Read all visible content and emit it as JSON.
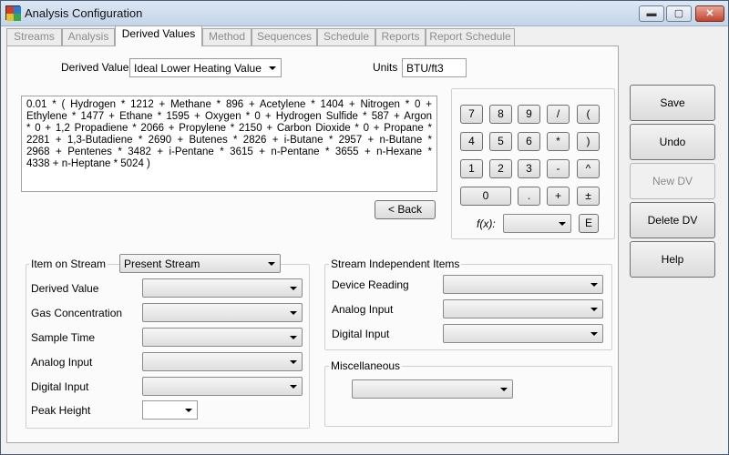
{
  "window": {
    "title": "Analysis Configuration",
    "controls": {
      "minimize": "▬",
      "maximize": "▢",
      "close": "✕"
    }
  },
  "tabs": [
    {
      "label": "Streams",
      "active": false
    },
    {
      "label": "Analysis",
      "active": false
    },
    {
      "label": "Derived Values",
      "active": true
    },
    {
      "label": "Method",
      "active": false
    },
    {
      "label": "Sequences",
      "active": false
    },
    {
      "label": "Schedule",
      "active": false
    },
    {
      "label": "Reports",
      "active": false
    },
    {
      "label": "Report Schedule",
      "active": false
    }
  ],
  "derived_value": {
    "label": "Derived Value",
    "selected": "Ideal Lower Heating Value"
  },
  "units": {
    "label": "Units",
    "value": "BTU/ft3"
  },
  "expression": {
    "lines": [
      "0.01 * ( Hydrogen * 1212 + Methane * 896 + Acetylene * 1404 + Nitrogen * 0 +",
      "Ethylene * 1477 + Ethane * 1595 + Oxygen * 0 + Hydrogen Sulfide * 587 + Argon",
      "* 0 + 1,2 Propadiene * 2066 + Propylene * 2150 + Carbon Dioxide * 0 + Propane *",
      "2281 + 1,3-Butadiene * 2690 + Butenes * 2826 + i-Butane * 2957 + n-Butane *",
      "2968 + Pentenes * 3482 + i-Pentane * 3615 + n-Pentane * 3655 + n-Hexane *",
      "4338 + n-Heptane * 5024 )"
    ]
  },
  "back_button": "< Back",
  "calculator": {
    "keys": [
      "7",
      "8",
      "9",
      "/",
      "(",
      "4",
      "5",
      "6",
      "*",
      ")",
      "1",
      "2",
      "3",
      "-",
      "^",
      "0",
      ".",
      "+",
      "±"
    ],
    "fx_label": "f(x):",
    "e_key": "E"
  },
  "side_buttons": {
    "save": "Save",
    "undo": "Undo",
    "new_dv": "New DV",
    "delete_dv": "Delete DV",
    "help": "Help"
  },
  "item_on_stream": {
    "label": "Item on Stream",
    "selected": "Present Stream",
    "fields": [
      {
        "label": "Derived Value",
        "value": ""
      },
      {
        "label": "Gas Concentration",
        "value": ""
      },
      {
        "label": "Sample Time",
        "value": ""
      },
      {
        "label": "Analog Input",
        "value": ""
      },
      {
        "label": "Digital Input",
        "value": ""
      },
      {
        "label": "Peak Height",
        "value": ""
      }
    ]
  },
  "stream_independent": {
    "title": "Stream Independent Items",
    "fields": [
      {
        "label": "Device Reading",
        "value": ""
      },
      {
        "label": "Analog Input",
        "value": ""
      },
      {
        "label": "Digital Input",
        "value": ""
      }
    ]
  },
  "miscellaneous": {
    "title": "Miscellaneous",
    "value": ""
  }
}
